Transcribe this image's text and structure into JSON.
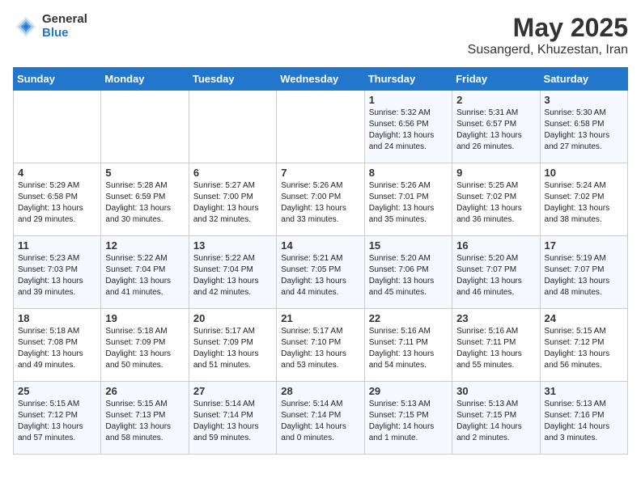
{
  "logo": {
    "general": "General",
    "blue": "Blue"
  },
  "title": "May 2025",
  "subtitle": "Susangerd, Khuzestan, Iran",
  "days_header": [
    "Sunday",
    "Monday",
    "Tuesday",
    "Wednesday",
    "Thursday",
    "Friday",
    "Saturday"
  ],
  "weeks": [
    [
      {
        "day": "",
        "info": ""
      },
      {
        "day": "",
        "info": ""
      },
      {
        "day": "",
        "info": ""
      },
      {
        "day": "",
        "info": ""
      },
      {
        "day": "1",
        "info": "Sunrise: 5:32 AM\nSunset: 6:56 PM\nDaylight: 13 hours\nand 24 minutes."
      },
      {
        "day": "2",
        "info": "Sunrise: 5:31 AM\nSunset: 6:57 PM\nDaylight: 13 hours\nand 26 minutes."
      },
      {
        "day": "3",
        "info": "Sunrise: 5:30 AM\nSunset: 6:58 PM\nDaylight: 13 hours\nand 27 minutes."
      }
    ],
    [
      {
        "day": "4",
        "info": "Sunrise: 5:29 AM\nSunset: 6:58 PM\nDaylight: 13 hours\nand 29 minutes."
      },
      {
        "day": "5",
        "info": "Sunrise: 5:28 AM\nSunset: 6:59 PM\nDaylight: 13 hours\nand 30 minutes."
      },
      {
        "day": "6",
        "info": "Sunrise: 5:27 AM\nSunset: 7:00 PM\nDaylight: 13 hours\nand 32 minutes."
      },
      {
        "day": "7",
        "info": "Sunrise: 5:26 AM\nSunset: 7:00 PM\nDaylight: 13 hours\nand 33 minutes."
      },
      {
        "day": "8",
        "info": "Sunrise: 5:26 AM\nSunset: 7:01 PM\nDaylight: 13 hours\nand 35 minutes."
      },
      {
        "day": "9",
        "info": "Sunrise: 5:25 AM\nSunset: 7:02 PM\nDaylight: 13 hours\nand 36 minutes."
      },
      {
        "day": "10",
        "info": "Sunrise: 5:24 AM\nSunset: 7:02 PM\nDaylight: 13 hours\nand 38 minutes."
      }
    ],
    [
      {
        "day": "11",
        "info": "Sunrise: 5:23 AM\nSunset: 7:03 PM\nDaylight: 13 hours\nand 39 minutes."
      },
      {
        "day": "12",
        "info": "Sunrise: 5:22 AM\nSunset: 7:04 PM\nDaylight: 13 hours\nand 41 minutes."
      },
      {
        "day": "13",
        "info": "Sunrise: 5:22 AM\nSunset: 7:04 PM\nDaylight: 13 hours\nand 42 minutes."
      },
      {
        "day": "14",
        "info": "Sunrise: 5:21 AM\nSunset: 7:05 PM\nDaylight: 13 hours\nand 44 minutes."
      },
      {
        "day": "15",
        "info": "Sunrise: 5:20 AM\nSunset: 7:06 PM\nDaylight: 13 hours\nand 45 minutes."
      },
      {
        "day": "16",
        "info": "Sunrise: 5:20 AM\nSunset: 7:07 PM\nDaylight: 13 hours\nand 46 minutes."
      },
      {
        "day": "17",
        "info": "Sunrise: 5:19 AM\nSunset: 7:07 PM\nDaylight: 13 hours\nand 48 minutes."
      }
    ],
    [
      {
        "day": "18",
        "info": "Sunrise: 5:18 AM\nSunset: 7:08 PM\nDaylight: 13 hours\nand 49 minutes."
      },
      {
        "day": "19",
        "info": "Sunrise: 5:18 AM\nSunset: 7:09 PM\nDaylight: 13 hours\nand 50 minutes."
      },
      {
        "day": "20",
        "info": "Sunrise: 5:17 AM\nSunset: 7:09 PM\nDaylight: 13 hours\nand 51 minutes."
      },
      {
        "day": "21",
        "info": "Sunrise: 5:17 AM\nSunset: 7:10 PM\nDaylight: 13 hours\nand 53 minutes."
      },
      {
        "day": "22",
        "info": "Sunrise: 5:16 AM\nSunset: 7:11 PM\nDaylight: 13 hours\nand 54 minutes."
      },
      {
        "day": "23",
        "info": "Sunrise: 5:16 AM\nSunset: 7:11 PM\nDaylight: 13 hours\nand 55 minutes."
      },
      {
        "day": "24",
        "info": "Sunrise: 5:15 AM\nSunset: 7:12 PM\nDaylight: 13 hours\nand 56 minutes."
      }
    ],
    [
      {
        "day": "25",
        "info": "Sunrise: 5:15 AM\nSunset: 7:12 PM\nDaylight: 13 hours\nand 57 minutes."
      },
      {
        "day": "26",
        "info": "Sunrise: 5:15 AM\nSunset: 7:13 PM\nDaylight: 13 hours\nand 58 minutes."
      },
      {
        "day": "27",
        "info": "Sunrise: 5:14 AM\nSunset: 7:14 PM\nDaylight: 13 hours\nand 59 minutes."
      },
      {
        "day": "28",
        "info": "Sunrise: 5:14 AM\nSunset: 7:14 PM\nDaylight: 14 hours\nand 0 minutes."
      },
      {
        "day": "29",
        "info": "Sunrise: 5:13 AM\nSunset: 7:15 PM\nDaylight: 14 hours\nand 1 minute."
      },
      {
        "day": "30",
        "info": "Sunrise: 5:13 AM\nSunset: 7:15 PM\nDaylight: 14 hours\nand 2 minutes."
      },
      {
        "day": "31",
        "info": "Sunrise: 5:13 AM\nSunset: 7:16 PM\nDaylight: 14 hours\nand 3 minutes."
      }
    ]
  ]
}
